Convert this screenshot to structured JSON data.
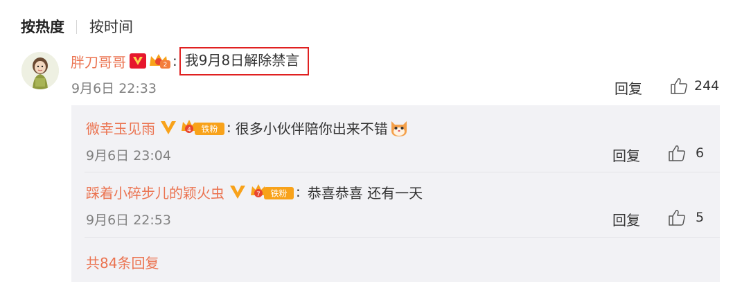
{
  "sort_tabs": [
    {
      "label": "按热度",
      "active": true
    },
    {
      "label": "按时间",
      "active": false
    }
  ],
  "comment": {
    "author": "胖刀哥哥",
    "badge_level": "2",
    "colon": ":",
    "text": "我9月8日解除禁言",
    "time": "9月6日 22:33",
    "reply_label": "回复",
    "likes": "244"
  },
  "replies": [
    {
      "author": "微幸玉见雨",
      "fan_level": "4",
      "fan_label": "铁粉",
      "colon": ":",
      "text": "很多小伙伴陪你出来不错",
      "emoji": "cat-emoji",
      "time": "9月6日 23:04",
      "reply_label": "回复",
      "likes": "6"
    },
    {
      "author": "踩着小碎步儿的颖火虫",
      "fan_level": "7",
      "fan_label": "铁粉",
      "colon": ":",
      "text": "恭喜恭喜 还有一天",
      "time": "9月6日 22:53",
      "reply_label": "回复",
      "likes": "5"
    }
  ],
  "more_replies": "共84条回复",
  "colors": {
    "username": "#eb7350",
    "text": "#333333",
    "meta": "#808080",
    "highlight_border": "#e02020",
    "reply_bg": "#f2f2f5",
    "vip_red": "#e6162d",
    "vip_orange": "#f8a21a"
  }
}
